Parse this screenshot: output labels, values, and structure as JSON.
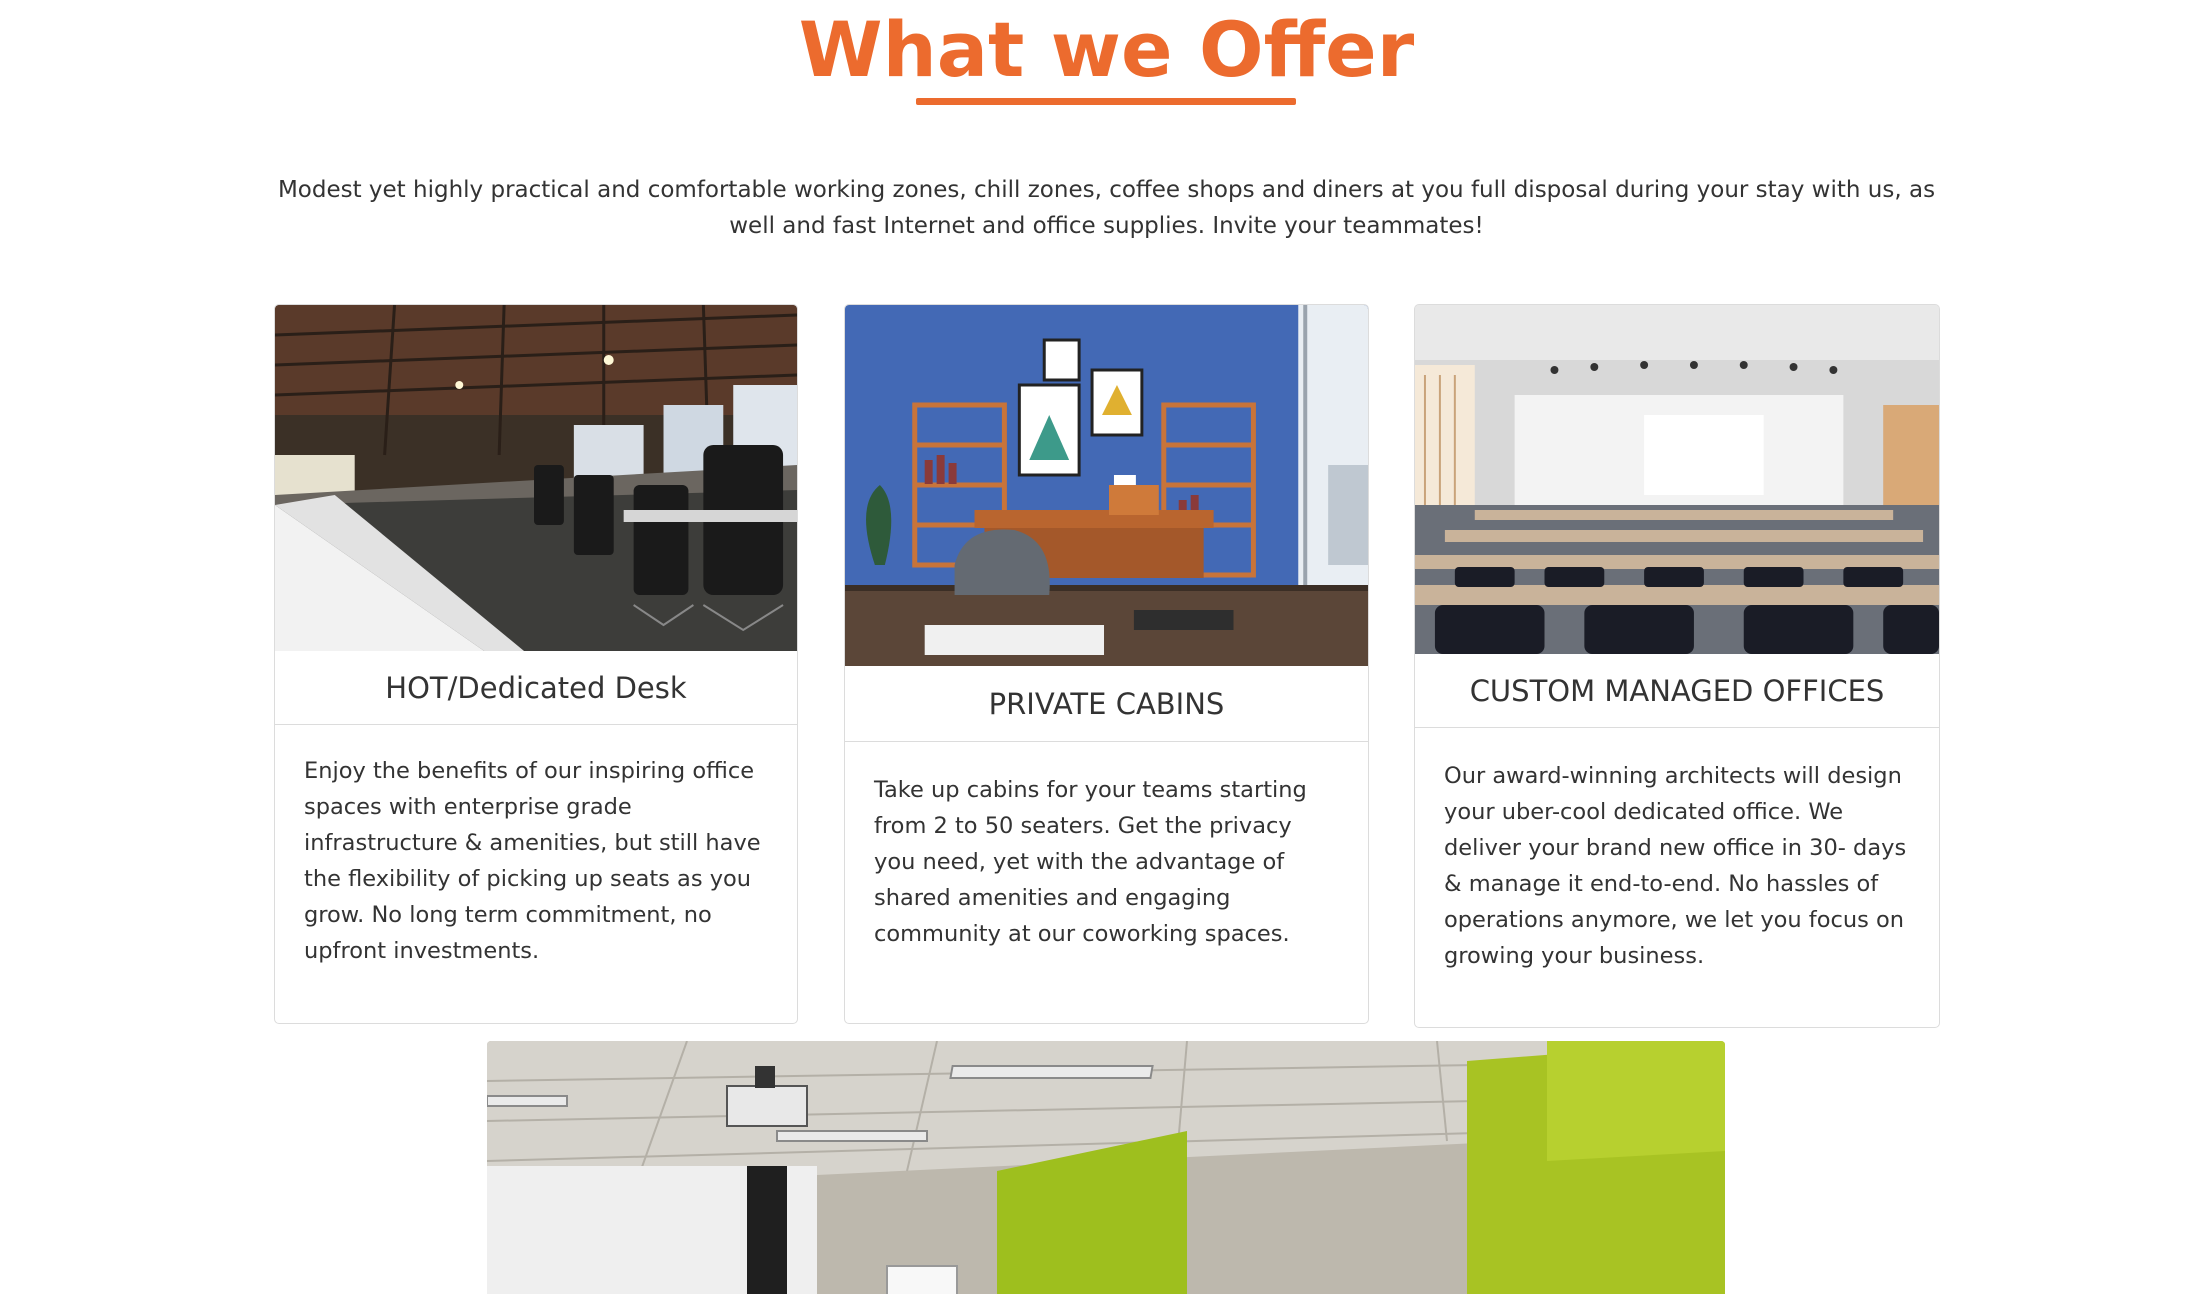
{
  "section": {
    "title": "What we Offer",
    "intro": "Modest yet highly practical and comfortable working zones, chill zones, coffee shops and diners at you full disposal during your stay with us, as well and fast Internet and office supplies. Invite your teammates!",
    "accent_color": "#ec6b2e"
  },
  "cards": [
    {
      "title": "HOT/Dedicated Desk",
      "description": "Enjoy the benefits of our inspiring office spaces with enterprise grade infrastructure & amenities, but still have the flexibility of picking up seats as you grow. No long term commitment, no upfront investments.",
      "image": "open-office-photo"
    },
    {
      "title": "PRIVATE CABINS",
      "description": "Take up cabins for your teams starting from 2 to 50 seaters. Get the privacy you need, yet with the advantage of shared amenities and engaging community at our coworking spaces.",
      "image": "private-cabin-photo"
    },
    {
      "title": "CUSTOM MANAGED OFFICES",
      "description": "Our award-winning architects will design your uber-cool dedicated office. We deliver your brand new office in 30- days & manage it end-to-end. No hassles of operations anymore, we let you focus on growing your business.",
      "image": "conference-hall-photo"
    }
  ],
  "bottom_image": "meeting-room-photo"
}
